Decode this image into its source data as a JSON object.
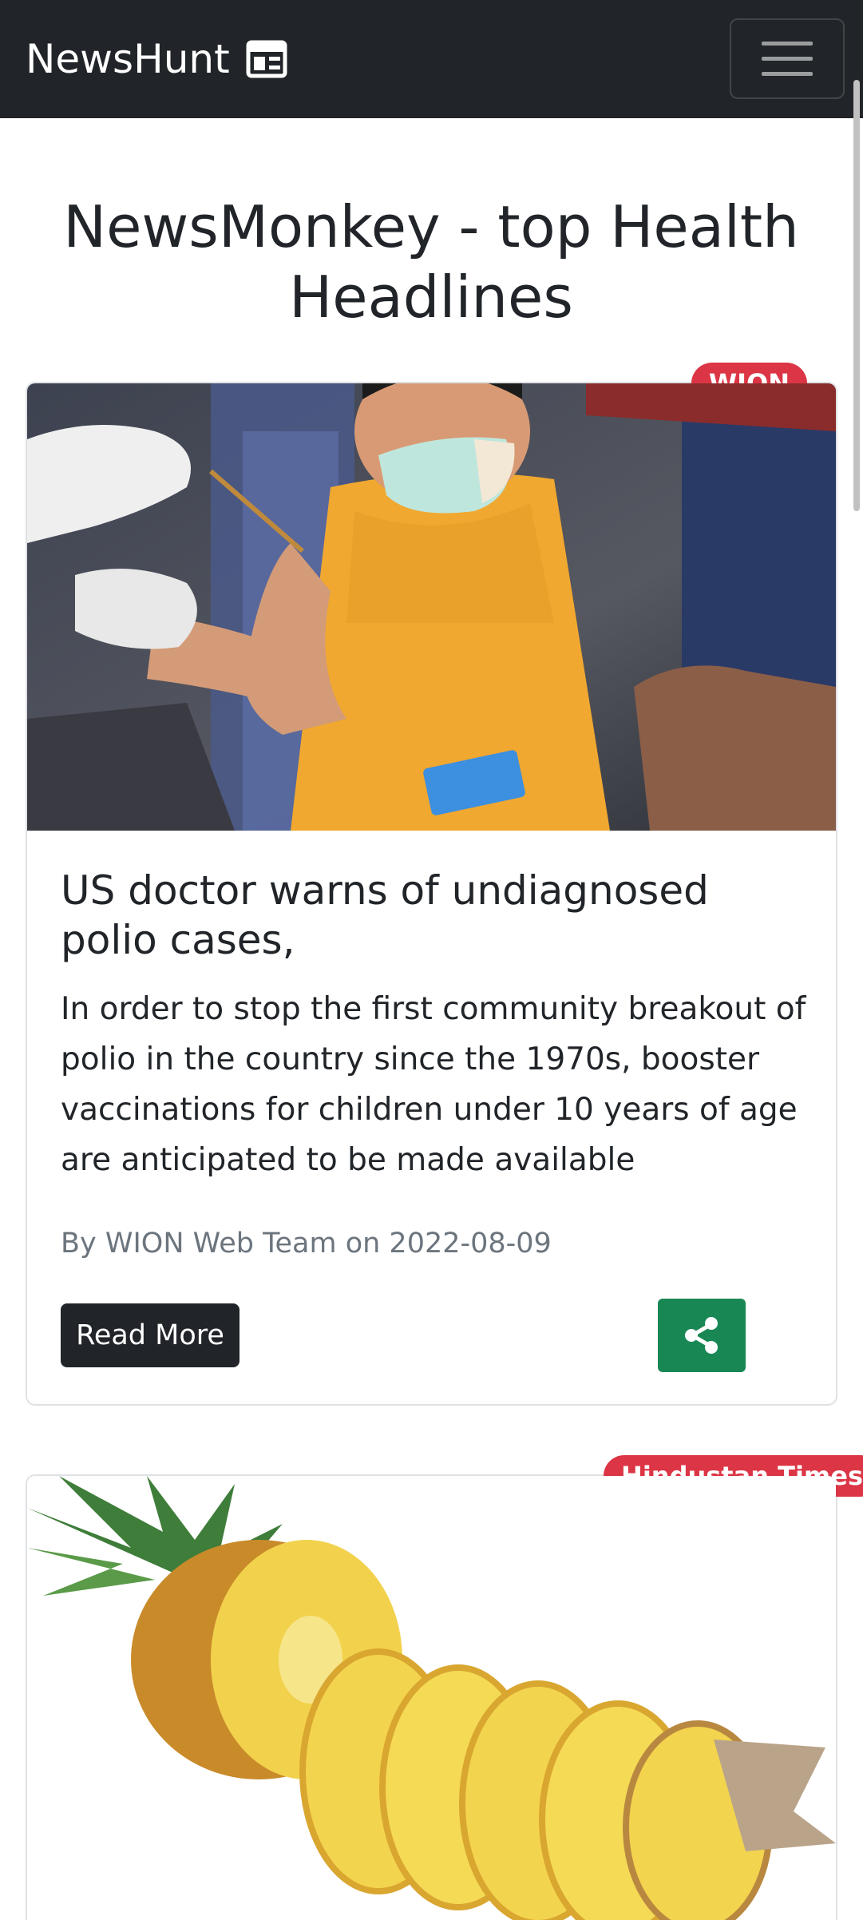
{
  "navbar": {
    "brand": "NewsHunt",
    "brand_icon": "newspaper-icon",
    "toggler_icon": "hamburger-menu-icon"
  },
  "page": {
    "title": "NewsMonkey - top Health Headlines"
  },
  "articles": [
    {
      "source": "WION",
      "image": "child-receiving-vaccine-photo",
      "title": "US doctor warns of undiagnosed polio cases,",
      "description": "In order to stop the first community breakout of polio in the country since the 1970s, booster vaccinations for children under 10 years of age are anticipated to be made available",
      "byline": "By WION Web Team on 2022-08-09",
      "read_more": "Read More",
      "share_icon": "share-icon"
    },
    {
      "source": "Hindustan Times",
      "image": "sliced-pineapple-photo"
    }
  ],
  "colors": {
    "navbar_bg": "#212529",
    "badge_bg": "#dc3545",
    "share_bg": "#198754",
    "button_bg": "#212529"
  }
}
